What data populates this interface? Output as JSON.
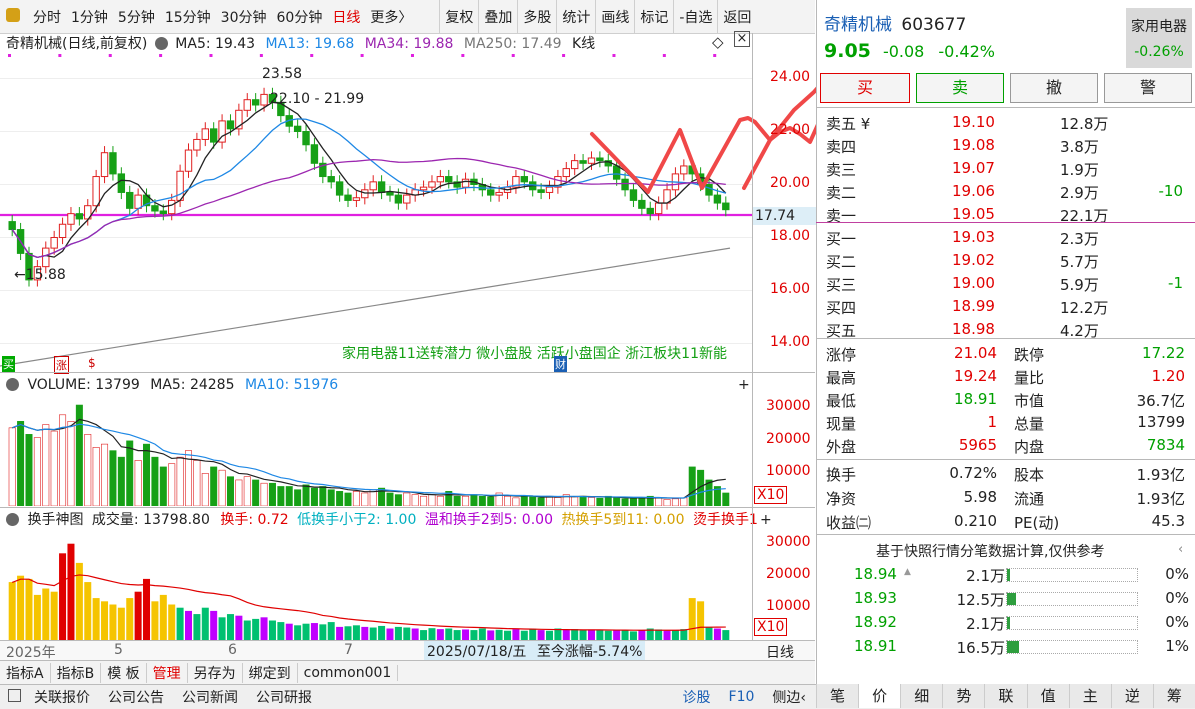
{
  "toolbar": {
    "left": [
      "分时",
      "1分钟",
      "5分钟",
      "15分钟",
      "30分钟",
      "60分钟",
      "日线",
      "更多〉"
    ],
    "right": [
      "复权",
      "叠加",
      "多股",
      "统计",
      "画线",
      "标记",
      "-自选",
      "返回"
    ],
    "active": "日线"
  },
  "main_header": {
    "name": "奇精机械(日线,前复权)",
    "ma5": "MA5: 19.43",
    "ma13": "MA13: 19.68",
    "ma34": "MA34: 19.88",
    "ma250": "MA250: 17.49",
    "kind": "K线",
    "diamond": "◇",
    "close_btn": "×"
  },
  "price_axis": [
    "24.00",
    "22.00",
    "20.00",
    "18.00",
    "16.00",
    "14.00"
  ],
  "price_box": "17.74",
  "annotations": {
    "high": "23.58",
    "range": "22.10 - 21.99",
    "low": "←15.88"
  },
  "concepts": "家用电器11送转潜力 微小盘股 活跃小盘国企 浙江板块11新能",
  "markers": {
    "m1": "买",
    "m2": "涨",
    "m3": "$",
    "m4": "财"
  },
  "volume_header": {
    "label": "VOLUME: 13799",
    "ma5": "MA5: 24285",
    "ma10": "MA10: 51976",
    "plus": "+"
  },
  "volume_axis": [
    "30000",
    "20000",
    "10000"
  ],
  "volume_unit": "X10",
  "turnover_header": {
    "title": "换手神图",
    "vol": "成交量: 13798.80",
    "hs": "换手: 0.72",
    "low": "低换手小于2: 1.00",
    "mild": "温和换手2到5: 0.00",
    "hot": "热换手5到11: 0.00",
    "burn": "烫手换手1",
    "plus": "+"
  },
  "turnover_axis": [
    "30000",
    "20000",
    "10000"
  ],
  "turnover_unit": "X10",
  "date_bar": {
    "d1": "2025年",
    "d2": "5",
    "d3": "6",
    "d4": "7",
    "date": "2025/07/18/五",
    "change": "至今涨幅-5.74%",
    "period": "日线"
  },
  "bottom_tabs": [
    "指标A",
    "指标B",
    "模 板",
    "管理",
    "另存为",
    "绑定到",
    "common001"
  ],
  "footer": {
    "items": [
      "关联报价",
      "公司公告",
      "公司新闻",
      "公司研报"
    ],
    "right": [
      "诊股",
      "F10",
      "侧边‹"
    ]
  },
  "stock": {
    "name": "奇精机械",
    "code": "603677",
    "sector": "家用电器",
    "sector_change": "-0.26%",
    "price": "9.05",
    "change": "-0.08",
    "pct": "-0.42%"
  },
  "trade_buttons": [
    "买",
    "卖",
    "撤",
    "警"
  ],
  "asks": [
    {
      "label": "卖五 ¥",
      "price": "19.10",
      "vol": "12.8万",
      "delta": ""
    },
    {
      "label": "卖四",
      "price": "19.08",
      "vol": "3.8万",
      "delta": ""
    },
    {
      "label": "卖三",
      "price": "19.07",
      "vol": "1.9万",
      "delta": ""
    },
    {
      "label": "卖二",
      "price": "19.06",
      "vol": "2.9万",
      "delta": "-10"
    },
    {
      "label": "卖一",
      "price": "19.05",
      "vol": "22.1万",
      "delta": ""
    }
  ],
  "bids": [
    {
      "label": "买一",
      "price": "19.03",
      "vol": "2.3万",
      "delta": ""
    },
    {
      "label": "买二",
      "price": "19.02",
      "vol": "5.7万",
      "delta": ""
    },
    {
      "label": "买三",
      "price": "19.00",
      "vol": "5.9万",
      "delta": "-1"
    },
    {
      "label": "买四",
      "price": "18.99",
      "vol": "12.2万",
      "delta": ""
    },
    {
      "label": "买五",
      "price": "18.98",
      "vol": "4.2万",
      "delta": ""
    }
  ],
  "stats1": [
    [
      "涨停",
      "21.04",
      "跌停",
      "17.22"
    ],
    [
      "最高",
      "19.24",
      "量比",
      "1.20"
    ],
    [
      "最低",
      "18.91",
      "市值",
      "36.7亿"
    ],
    [
      "现量",
      "1",
      "总量",
      "13799"
    ],
    [
      "外盘",
      "5965",
      "内盘",
      "7834"
    ]
  ],
  "stats2": [
    [
      "换手",
      "0.72%",
      "股本",
      "1.93亿"
    ],
    [
      "净资",
      "5.98",
      "流通",
      "1.93亿"
    ],
    [
      "收益㈡",
      "0.210",
      "PE(动)",
      "45.3"
    ]
  ],
  "dist_title": "基于快照行情分笔数据计算,仅供参考",
  "dist": [
    {
      "price": "18.94",
      "vol": "2.1万",
      "pct": "0%",
      "fill": 0.01,
      "arrow": "▲"
    },
    {
      "price": "18.93",
      "vol": "12.5万",
      "pct": "0%",
      "fill": 0.07,
      "arrow": ""
    },
    {
      "price": "18.92",
      "vol": "2.1万",
      "pct": "0%",
      "fill": 0.01,
      "arrow": ""
    },
    {
      "price": "18.91",
      "vol": "16.5万",
      "pct": "1%",
      "fill": 0.09,
      "arrow": ""
    }
  ],
  "side_tabs": [
    "笔",
    "价",
    "细",
    "势",
    "联",
    "值",
    "主",
    "逆",
    "筹"
  ],
  "side_tab_active": "价",
  "chart_data": [
    {
      "type": "candlestick",
      "title": "奇精机械(日线,前复权)",
      "ylim": [
        13.0,
        25.0
      ],
      "series": [
        {
          "name": "MA5",
          "last": 19.43
        },
        {
          "name": "MA13",
          "last": 19.68
        },
        {
          "name": "MA34",
          "last": 19.88
        },
        {
          "name": "MA250",
          "last": 17.49
        }
      ],
      "closes": [
        18.3,
        17.4,
        16.4,
        16.9,
        17.6,
        18.0,
        18.5,
        18.9,
        18.7,
        19.2,
        20.3,
        21.2,
        20.4,
        19.7,
        19.1,
        19.6,
        19.2,
        19.0,
        18.9,
        19.4,
        20.5,
        21.3,
        21.7,
        22.1,
        21.6,
        22.4,
        22.1,
        22.8,
        23.2,
        23.0,
        23.4,
        23.1,
        22.6,
        22.2,
        22.0,
        21.5,
        20.8,
        20.3,
        20.1,
        19.6,
        19.4,
        19.5,
        19.8,
        20.1,
        19.7,
        19.6,
        19.3,
        19.6,
        19.8,
        19.9,
        20.1,
        20.3,
        20.1,
        19.9,
        20.2,
        20.0,
        19.8,
        19.6,
        19.7,
        19.9,
        20.3,
        20.1,
        19.8,
        19.7,
        19.9,
        20.3,
        20.6,
        20.9,
        20.8,
        21.0,
        20.9,
        20.7,
        20.2,
        19.8,
        19.4,
        19.1,
        18.9,
        19.3,
        19.8,
        20.4,
        20.7,
        20.4,
        20.0,
        19.6,
        19.3,
        19.05
      ],
      "highlight_line": 18.85,
      "low_marker": 15.88,
      "high_marker": 23.58
    },
    {
      "type": "bar",
      "title": "VOLUME",
      "ylim": [
        0,
        35000
      ],
      "values": [
        24000,
        26000,
        22000,
        21000,
        25000,
        23000,
        28000,
        26000,
        31000,
        22000,
        18000,
        19000,
        17000,
        15000,
        20000,
        14000,
        19000,
        15000,
        12000,
        13000,
        15000,
        17000,
        14000,
        10000,
        12000,
        11000,
        9000,
        8000,
        9000,
        8000,
        7000,
        7000,
        6000,
        6000,
        5000,
        6500,
        5500,
        6000,
        5000,
        4500,
        4000,
        4500,
        4000,
        5000,
        5500,
        4000,
        3500,
        4000,
        3500,
        3000,
        3500,
        3000,
        4500,
        3000,
        3000,
        3500,
        3000,
        2800,
        4000,
        3000,
        2500,
        3000,
        2800,
        2500,
        3000,
        2600,
        3500,
        2800,
        3000,
        2600,
        2400,
        3000,
        2500,
        2200,
        2300,
        2500,
        3000,
        2500,
        2000,
        2200,
        2500,
        12000,
        11000,
        8000,
        6000,
        4000
      ],
      "series": [
        {
          "name": "MA5",
          "last": 24285
        },
        {
          "name": "MA10",
          "last": 51976
        }
      ]
    },
    {
      "type": "bar",
      "title": "换手神图",
      "ylim": [
        0,
        35000
      ],
      "values": [
        18000,
        20000,
        19000,
        14000,
        16000,
        15000,
        27000,
        30000,
        24000,
        18000,
        13000,
        12000,
        11000,
        10000,
        13000,
        15000,
        19000,
        12000,
        14000,
        11000,
        10000,
        9000,
        8000,
        10000,
        9000,
        7000,
        8000,
        7500,
        6000,
        6500,
        7000,
        6000,
        5500,
        5000,
        4500,
        5000,
        5200,
        4800,
        5500,
        4000,
        4200,
        4500,
        4000,
        3800,
        4300,
        3500,
        4000,
        3800,
        3500,
        3000,
        3600,
        3300,
        3500,
        3000,
        3200,
        3000,
        3500,
        2900,
        3100,
        2800,
        3300,
        2800,
        3400,
        3000,
        2800,
        3500,
        3100,
        3300,
        2900,
        3200,
        3000,
        2800,
        3100,
        3000,
        2600,
        3000,
        3500,
        3200,
        2800,
        3000,
        3300,
        13000,
        12000,
        4000,
        3500,
        3000
      ]
    }
  ]
}
